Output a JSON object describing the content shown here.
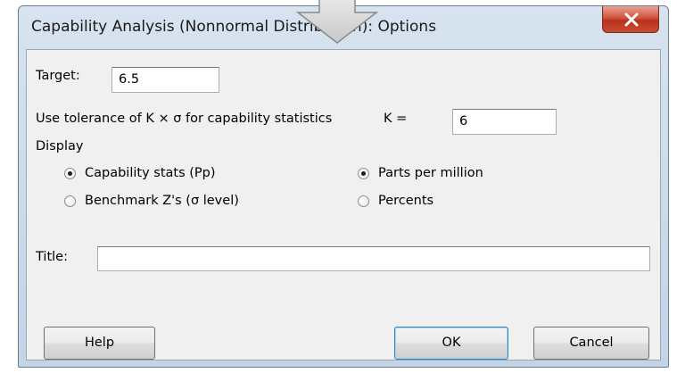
{
  "window": {
    "title": "Capability Analysis (Nonnormal Distribution): Options"
  },
  "target": {
    "label": "Target:",
    "value": "6.5"
  },
  "tolerance": {
    "label": "Use tolerance of K × σ for capability statistics",
    "k_label": "K =",
    "k_value": "6"
  },
  "display": {
    "label": "Display",
    "options_left": [
      {
        "label": "Capability stats (Pp)",
        "checked": true
      },
      {
        "label": "Benchmark Z's (σ level)",
        "checked": false
      }
    ],
    "options_right": [
      {
        "label": "Parts per million",
        "checked": true
      },
      {
        "label": "Percents",
        "checked": false
      }
    ]
  },
  "title_field": {
    "label": "Title:",
    "value": ""
  },
  "buttons": {
    "help": "Help",
    "ok": "OK",
    "cancel": "Cancel"
  }
}
